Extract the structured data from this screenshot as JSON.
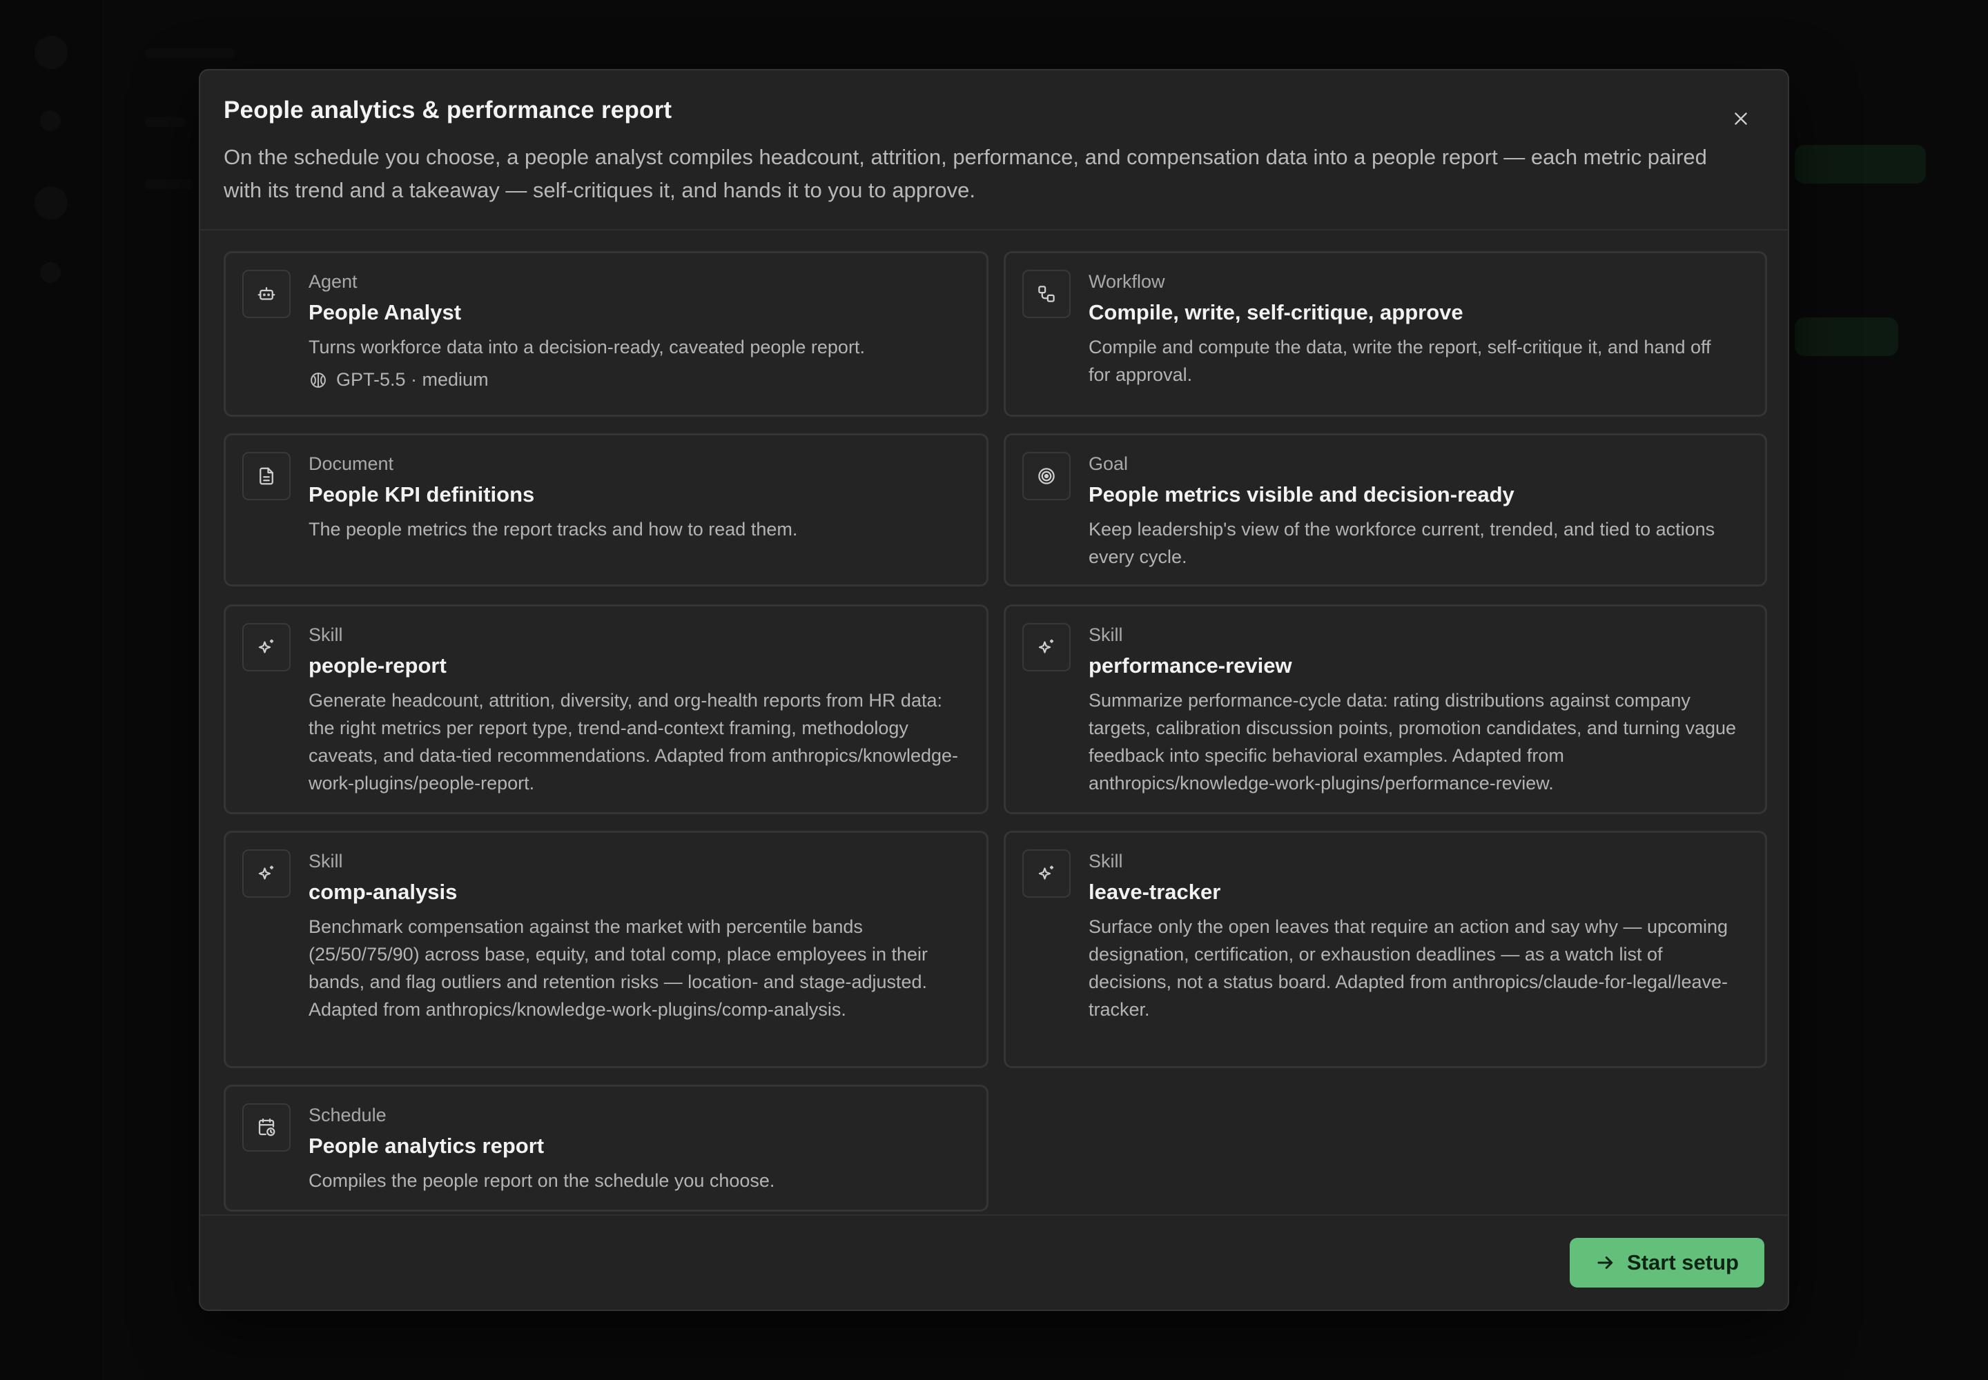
{
  "modal": {
    "title": "People analytics & performance report",
    "description": "On the schedule you choose, a people analyst compiles headcount, attrition, performance, and compensation data into a people report — each metric paired with its trend and a takeaway — self-critiques it, and hands it to you to approve.",
    "close_icon": "close-icon"
  },
  "cards": [
    {
      "kind": "Agent",
      "title": "People Analyst",
      "text": "Turns workforce data into a decision-ready, caveated people report.",
      "meta": "GPT-5.5 · medium",
      "icon": "robot-icon"
    },
    {
      "kind": "Workflow",
      "title": "Compile, write, self-critique, approve",
      "text": "Compile and compute the data, write the report, self-critique it, and hand off for approval.",
      "icon": "workflow-icon"
    },
    {
      "kind": "Document",
      "title": "People KPI definitions",
      "text": "The people metrics the report tracks and how to read them.",
      "icon": "document-icon"
    },
    {
      "kind": "Goal",
      "title": "People metrics visible and decision-ready",
      "text": "Keep leadership's view of the workforce current, trended, and tied to actions every cycle.",
      "icon": "target-icon"
    },
    {
      "kind": "Skill",
      "title": "people-report",
      "text": "Generate headcount, attrition, diversity, and org-health reports from HR data: the right metrics per report type, trend-and-context framing, methodology caveats, and data-tied recommendations. Adapted from anthropics/knowledge-work-plugins/people-report.",
      "icon": "sparkle-icon"
    },
    {
      "kind": "Skill",
      "title": "performance-review",
      "text": "Summarize performance-cycle data: rating distributions against company targets, calibration discussion points, promotion candidates, and turning vague feedback into specific behavioral examples. Adapted from anthropics/knowledge-work-plugins/performance-review.",
      "icon": "sparkle-icon"
    },
    {
      "kind": "Skill",
      "title": "comp-analysis",
      "text": "Benchmark compensation against the market with percentile bands (25/50/75/90) across base, equity, and total comp, place employees in their bands, and flag outliers and retention risks — location- and stage-adjusted. Adapted from anthropics/knowledge-work-plugins/comp-analysis.",
      "icon": "sparkle-icon"
    },
    {
      "kind": "Skill",
      "title": "leave-tracker",
      "text": "Surface only the open leaves that require an action and say why — upcoming designation, certification, or exhaustion deadlines — as a watch list of decisions, not a status board. Adapted from anthropics/claude-for-legal/leave-tracker.",
      "icon": "sparkle-icon"
    },
    {
      "kind": "Schedule",
      "title": "People analytics report",
      "text": "Compiles the people report on the schedule you choose.",
      "icon": "calendar-clock-icon"
    }
  ],
  "footer": {
    "start_label": "Start setup",
    "start_icon": "arrow-right-icon"
  },
  "colors": {
    "accent": "#63c07a",
    "modal_bg": "#232323",
    "card_border": "#353535"
  }
}
